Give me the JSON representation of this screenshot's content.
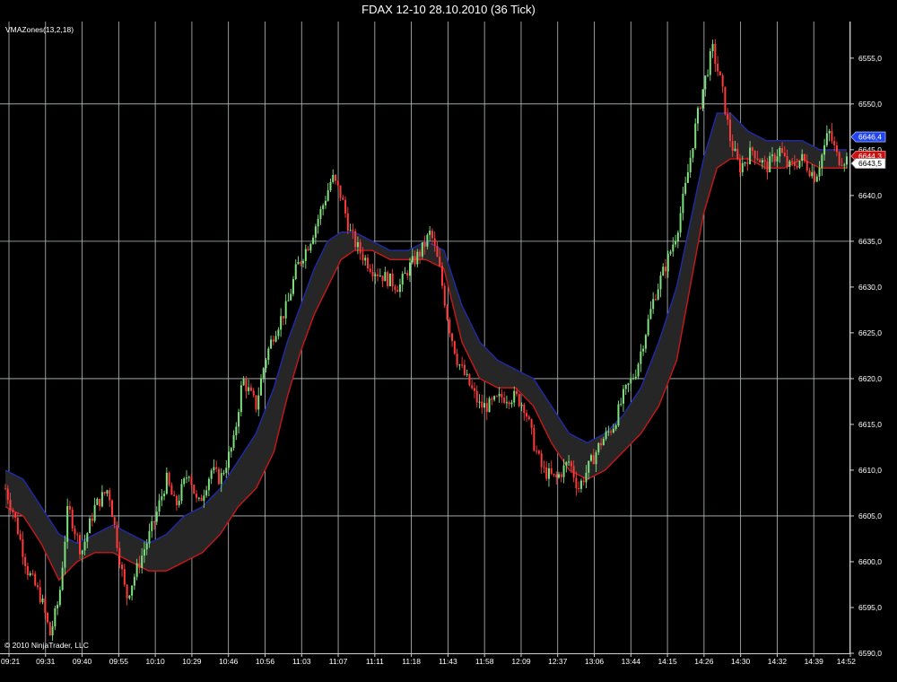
{
  "window": {
    "title": "FDAX 12-10  28.10.2010 (36 Tick)"
  },
  "indicator": {
    "label": "VMAZones(13,2,18)"
  },
  "copyright": "© 2010 NinjaTrader, LLC",
  "colors": {
    "background": "#000000",
    "grid": "#b9bfc0",
    "candle_up": "#7fe07f",
    "candle_down": "#ff3a3a",
    "zone_fill": "#262626",
    "zone_upper": "#1f2aa8",
    "zone_lower": "#c81818",
    "badge_blue": "#2244ee",
    "badge_red": "#cc1111",
    "badge_white": "#ffffff"
  },
  "chart_data": {
    "type": "line",
    "title": "FDAX 12-10  28.10.2010 (36 Tick)",
    "ylim": [
      6590,
      6659
    ],
    "y_ticks": [
      "6555,0",
      "6550,0",
      "6645,0",
      "6640,0",
      "6635,0",
      "6630,0",
      "6625,0",
      "6620,0",
      "6615,0",
      "6610,0",
      "6605,0",
      "6600,0",
      "6595,0",
      "6590,0"
    ],
    "y_tick_values": [
      6655,
      6650,
      6645,
      6640,
      6635,
      6630,
      6625,
      6620,
      6615,
      6610,
      6605,
      6600,
      6595,
      6590
    ],
    "x_ticks": [
      "09:21",
      "09:31",
      "09:40",
      "09:55",
      "10:10",
      "10:29",
      "10:46",
      "10:56",
      "11:03",
      "11:07",
      "11:11",
      "11:18",
      "11:43",
      "11:58",
      "12:09",
      "12:37",
      "13:06",
      "13:44",
      "14:15",
      "14:26",
      "14:30",
      "14:32",
      "14:39",
      "14:52"
    ],
    "grid_ticks": [
      6650,
      6635,
      6620,
      6605
    ],
    "price_path": [
      [
        0,
        6608
      ],
      [
        2,
        6605
      ],
      [
        5,
        6599
      ],
      [
        8,
        6596
      ],
      [
        10,
        6592
      ],
      [
        12,
        6596
      ],
      [
        14,
        6606
      ],
      [
        17,
        6601
      ],
      [
        20,
        6606
      ],
      [
        23,
        6608
      ],
      [
        25,
        6602
      ],
      [
        27,
        6596
      ],
      [
        30,
        6600
      ],
      [
        33,
        6604
      ],
      [
        36,
        6609
      ],
      [
        38,
        6606
      ],
      [
        41,
        6610
      ],
      [
        43,
        6606
      ],
      [
        46,
        6610
      ],
      [
        48,
        6609
      ],
      [
        51,
        6613
      ],
      [
        53,
        6620
      ],
      [
        56,
        6617
      ],
      [
        58,
        6622
      ],
      [
        60,
        6625
      ],
      [
        63,
        6628
      ],
      [
        65,
        6632
      ],
      [
        68,
        6635
      ],
      [
        71,
        6639
      ],
      [
        73,
        6642
      ],
      [
        75,
        6640
      ],
      [
        77,
        6636
      ],
      [
        79,
        6634
      ],
      [
        82,
        6632
      ],
      [
        85,
        6631
      ],
      [
        88,
        6630
      ],
      [
        90,
        6632
      ],
      [
        93,
        6634
      ],
      [
        95,
        6636
      ],
      [
        97,
        6632
      ],
      [
        99,
        6626
      ],
      [
        101,
        6622
      ],
      [
        103,
        6620
      ],
      [
        106,
        6617
      ],
      [
        108,
        6617
      ],
      [
        111,
        6618
      ],
      [
        114,
        6618
      ],
      [
        116,
        6617
      ],
      [
        118,
        6613
      ],
      [
        120,
        6610
      ],
      [
        123,
        6609
      ],
      [
        126,
        6611
      ],
      [
        128,
        6608
      ],
      [
        131,
        6611
      ],
      [
        133,
        6613
      ],
      [
        136,
        6615
      ],
      [
        138,
        6618
      ],
      [
        141,
        6621
      ],
      [
        143,
        6625
      ],
      [
        145,
        6629
      ],
      [
        148,
        6633
      ],
      [
        150,
        6636
      ],
      [
        152,
        6641
      ],
      [
        154,
        6647
      ],
      [
        156,
        6652
      ],
      [
        158,
        6656
      ],
      [
        160,
        6652
      ],
      [
        162,
        6646
      ],
      [
        164,
        6643
      ],
      [
        167,
        6645
      ],
      [
        170,
        6643
      ],
      [
        173,
        6645
      ],
      [
        175,
        6643
      ],
      [
        178,
        6644
      ],
      [
        181,
        6642
      ],
      [
        184,
        6647
      ],
      [
        186,
        6644
      ],
      [
        188,
        6644
      ]
    ],
    "vma_upper": [
      [
        0,
        6610
      ],
      [
        4,
        6609
      ],
      [
        8,
        6606
      ],
      [
        12,
        6603
      ],
      [
        16,
        6602
      ],
      [
        20,
        6603
      ],
      [
        24,
        6604
      ],
      [
        28,
        6603
      ],
      [
        32,
        6602
      ],
      [
        36,
        6603
      ],
      [
        40,
        6605
      ],
      [
        44,
        6606
      ],
      [
        48,
        6608
      ],
      [
        52,
        6611
      ],
      [
        56,
        6614
      ],
      [
        60,
        6619
      ],
      [
        63,
        6624
      ],
      [
        66,
        6628
      ],
      [
        69,
        6632
      ],
      [
        72,
        6635
      ],
      [
        75,
        6636
      ],
      [
        78,
        6636
      ],
      [
        82,
        6635
      ],
      [
        86,
        6634
      ],
      [
        90,
        6634
      ],
      [
        94,
        6635
      ],
      [
        98,
        6634
      ],
      [
        102,
        6628
      ],
      [
        106,
        6624
      ],
      [
        110,
        6622
      ],
      [
        114,
        6621
      ],
      [
        118,
        6620
      ],
      [
        122,
        6617
      ],
      [
        126,
        6614
      ],
      [
        130,
        6613
      ],
      [
        134,
        6614
      ],
      [
        138,
        6616
      ],
      [
        142,
        6619
      ],
      [
        146,
        6624
      ],
      [
        150,
        6630
      ],
      [
        153,
        6637
      ],
      [
        156,
        6644
      ],
      [
        159,
        6649
      ],
      [
        162,
        6649
      ],
      [
        166,
        6647
      ],
      [
        170,
        6646
      ],
      [
        174,
        6646
      ],
      [
        178,
        6646
      ],
      [
        182,
        6645
      ],
      [
        186,
        6645
      ],
      [
        188,
        6645
      ]
    ],
    "vma_lower": [
      [
        0,
        6606
      ],
      [
        4,
        6605
      ],
      [
        8,
        6602
      ],
      [
        12,
        6598
      ],
      [
        16,
        6600
      ],
      [
        20,
        6601
      ],
      [
        24,
        6601
      ],
      [
        28,
        6600
      ],
      [
        32,
        6599
      ],
      [
        36,
        6599
      ],
      [
        40,
        6600
      ],
      [
        44,
        6601
      ],
      [
        48,
        6603
      ],
      [
        52,
        6606
      ],
      [
        56,
        6608
      ],
      [
        60,
        6612
      ],
      [
        63,
        6618
      ],
      [
        66,
        6623
      ],
      [
        69,
        6627
      ],
      [
        72,
        6630
      ],
      [
        75,
        6633
      ],
      [
        78,
        6634
      ],
      [
        82,
        6634
      ],
      [
        86,
        6633
      ],
      [
        90,
        6633
      ],
      [
        94,
        6633
      ],
      [
        98,
        6632
      ],
      [
        102,
        6624
      ],
      [
        106,
        6620
      ],
      [
        110,
        6619
      ],
      [
        114,
        6619
      ],
      [
        118,
        6617
      ],
      [
        122,
        6613
      ],
      [
        126,
        6610
      ],
      [
        130,
        6609
      ],
      [
        134,
        6610
      ],
      [
        138,
        6612
      ],
      [
        142,
        6614
      ],
      [
        146,
        6617
      ],
      [
        150,
        6622
      ],
      [
        153,
        6630
      ],
      [
        156,
        6638
      ],
      [
        159,
        6643
      ],
      [
        162,
        6644
      ],
      [
        166,
        6644
      ],
      [
        170,
        6643
      ],
      [
        174,
        6643
      ],
      [
        178,
        6644
      ],
      [
        182,
        6643
      ],
      [
        186,
        6643
      ],
      [
        188,
        6643
      ]
    ],
    "price_labels": [
      {
        "text": "6646,4",
        "value": 6646.4,
        "style": "blue"
      },
      {
        "text": "6644,3",
        "value": 6644.3,
        "style": "red"
      },
      {
        "text": "6643,5",
        "value": 6643.5,
        "style": "white"
      }
    ],
    "series": [
      {
        "name": "VMAZones(13,2,18)"
      }
    ]
  }
}
